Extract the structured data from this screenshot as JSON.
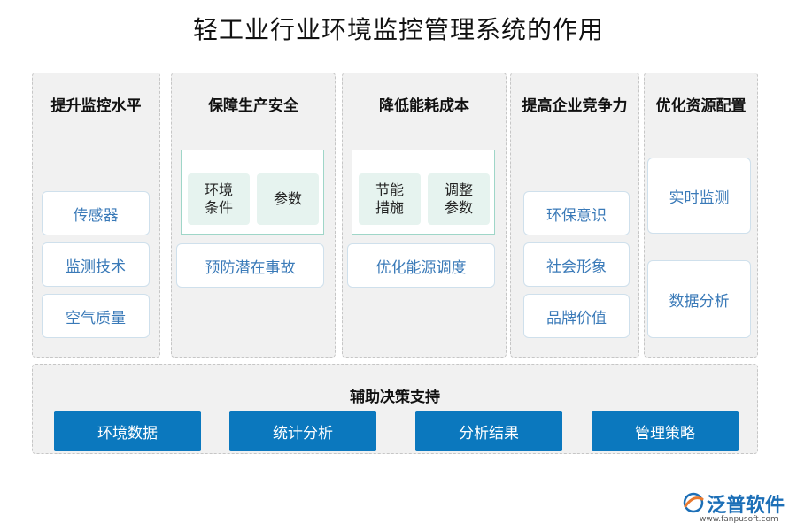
{
  "title": "轻工业行业环境监控管理系统的作用",
  "columns": [
    {
      "title": "提升监控水平",
      "items": [
        "传感器",
        "监测技术",
        "空气质量"
      ]
    },
    {
      "title": "保障生产安全",
      "group": [
        "环境\n条件",
        "参数"
      ],
      "items": [
        "预防潜在事故"
      ]
    },
    {
      "title": "降低能耗成本",
      "group": [
        "节能\n措施",
        "调整\n参数"
      ],
      "items": [
        "优化能源调度"
      ]
    },
    {
      "title": "提高企业竞争力",
      "items": [
        "环保意识",
        "社会形象",
        "品牌价值"
      ]
    },
    {
      "title": "优化资源配置",
      "items": [
        "实时监测",
        "数据分析"
      ]
    }
  ],
  "bottom": {
    "title": "辅助决策支持",
    "items": [
      "环境数据",
      "统计分析",
      "分析结果",
      "管理策略"
    ]
  },
  "logo": {
    "name": "泛普软件",
    "url": "www.fanpusoft.com"
  },
  "colors": {
    "accent": "#0b78be",
    "item_text": "#3a7ab8",
    "panel_bg": "#f1f1f1"
  }
}
